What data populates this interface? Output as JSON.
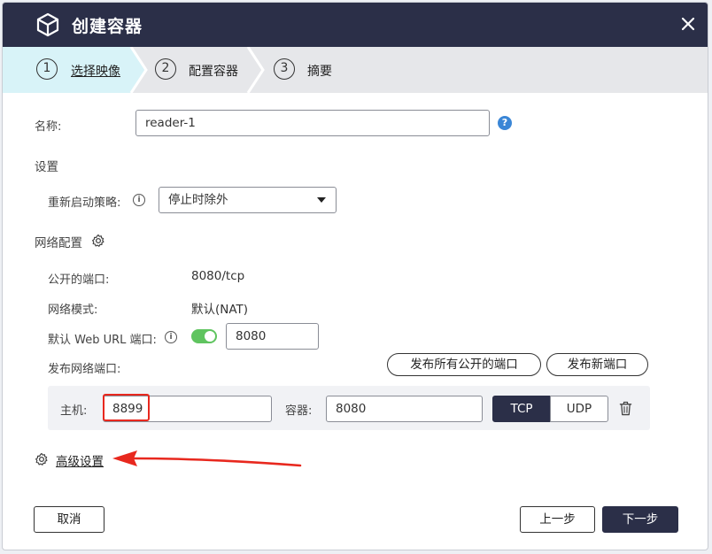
{
  "dialog": {
    "title": "创建容器",
    "icon": "cube-icon",
    "close_icon": "close-icon"
  },
  "steps": [
    {
      "num": "1",
      "label": "选择映像",
      "active": true
    },
    {
      "num": "2",
      "label": "配置容器",
      "active": false
    },
    {
      "num": "3",
      "label": "摘要",
      "active": false
    }
  ],
  "form": {
    "name_label": "名称:",
    "name_value": "reader-1",
    "settings_label": "设置",
    "restart_label": "重新启动策略:",
    "restart_value": "停止时除外",
    "network_label": "网络配置",
    "exposed_ports_label": "公开的端口:",
    "exposed_ports_value": "8080/tcp",
    "network_mode_label": "网络模式:",
    "network_mode_value": "默认(NAT)",
    "web_url_label": "默认 Web URL 端口:",
    "web_url_toggle_on": true,
    "web_url_port": "8080",
    "publish_ports_label": "发布网络端口:",
    "publish_all_button": "发布所有公开的端口",
    "publish_new_button": "发布新端口",
    "port_row": {
      "host_label": "主机:",
      "host_value": "8899",
      "container_label": "容器:",
      "container_value": "8080",
      "protocols": [
        "TCP",
        "UDP"
      ],
      "selected_protocol": "TCP"
    },
    "advanced_label": "高级设置"
  },
  "footer": {
    "cancel": "取消",
    "prev": "上一步",
    "next": "下一步"
  },
  "colors": {
    "titlebar": "#2b2f48",
    "active_step": "#d8f3f8",
    "toggle_on": "#5fc45f",
    "highlight": "#e8281e",
    "help": "#3a86d6"
  }
}
